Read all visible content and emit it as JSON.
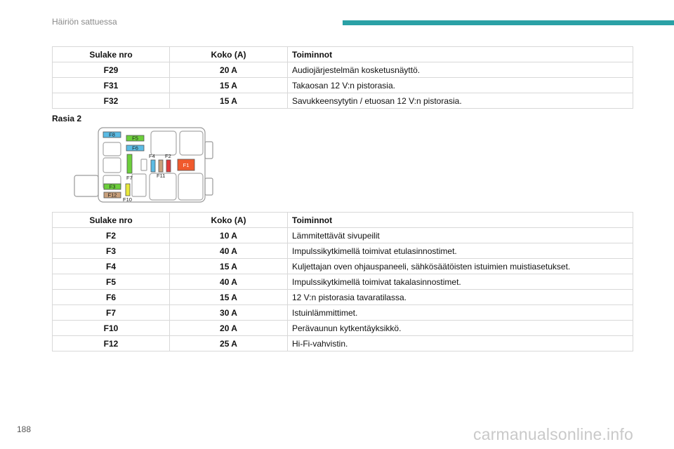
{
  "header": {
    "section_title": "Häiriön sattuessa",
    "accent_color": "#2aa1a6"
  },
  "table1": {
    "headers": [
      "Sulake nro",
      "Koko (A)",
      "Toiminnot"
    ],
    "rows": [
      {
        "fuse": "F29",
        "size": "20 A",
        "function": "Audiojärjestelmän kosketusnäyttö."
      },
      {
        "fuse": "F31",
        "size": "15 A",
        "function": "Takaosan 12 V:n pistorasia."
      },
      {
        "fuse": "F32",
        "size": "15 A",
        "function": "Savukkeensytytin / etuosan 12 V:n pistorasia."
      }
    ]
  },
  "box_label": "Rasia 2",
  "diagram": {
    "labels": {
      "F1": "F1",
      "F2": "F2",
      "F3": "F3",
      "F4": "F4",
      "F5": "F5",
      "F6": "F6",
      "F7": "F7",
      "F8": "F8",
      "F10": "F10",
      "F11": "F11",
      "F12": "F12"
    },
    "colors": {
      "F8": "#5bbbe4",
      "F5": "#6ccf3b",
      "F6": "#5bbbe4",
      "F7": "#6ccf3b",
      "F4": "#5bbbe4",
      "F11": "#c8a07c",
      "F2": "#e03a3a",
      "F1": "#f05a2c",
      "F3": "#6ccf3b",
      "F12": "#c8a07c",
      "F10": "#e8e83a"
    }
  },
  "table2": {
    "headers": [
      "Sulake nro",
      "Koko (A)",
      "Toiminnot"
    ],
    "rows": [
      {
        "fuse": "F2",
        "size": "10 A",
        "function": "Lämmitettävät sivupeilit"
      },
      {
        "fuse": "F3",
        "size": "40 A",
        "function": "Impulssikytkimellä toimivat etulasinnostimet."
      },
      {
        "fuse": "F4",
        "size": "15 A",
        "function": "Kuljettajan oven ohjauspaneeli, sähkösäätöisten istuimien muistiasetukset."
      },
      {
        "fuse": "F5",
        "size": "40 A",
        "function": "Impulssikytkimellä toimivat takalasinnostimet."
      },
      {
        "fuse": "F6",
        "size": "15 A",
        "function": "12 V:n pistorasia tavaratilassa."
      },
      {
        "fuse": "F7",
        "size": "30 A",
        "function": "Istuinlämmittimet."
      },
      {
        "fuse": "F10",
        "size": "20 A",
        "function": "Perävaunun kytkentäyksikkö."
      },
      {
        "fuse": "F12",
        "size": "25 A",
        "function": "Hi-Fi-vahvistin."
      }
    ]
  },
  "footer": {
    "page_number": "188",
    "watermark": "carmanualsonline.info"
  }
}
